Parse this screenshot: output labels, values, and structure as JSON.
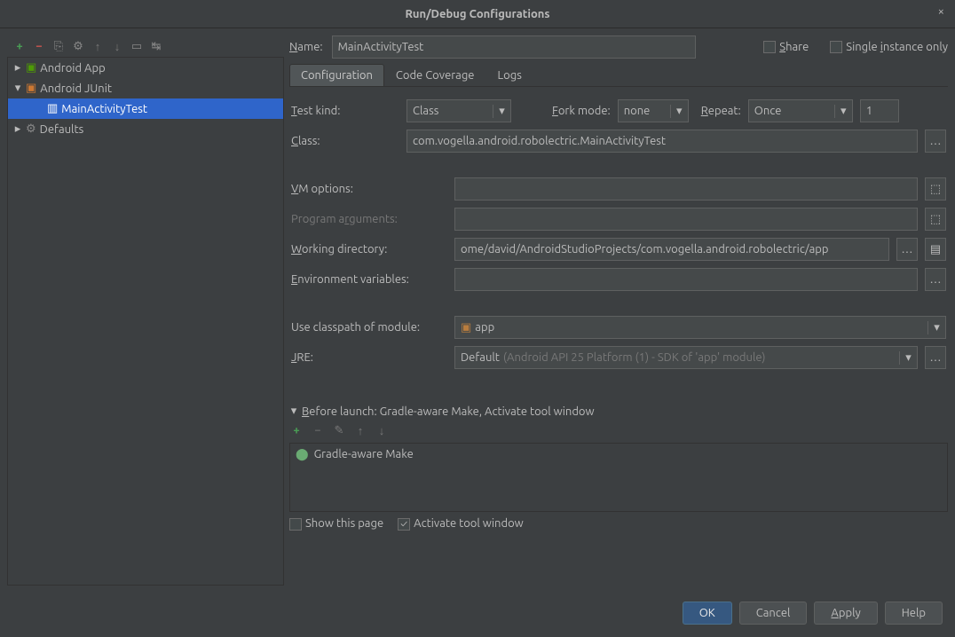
{
  "window": {
    "title": "Run/Debug Configurations"
  },
  "tree": {
    "items": [
      {
        "label": "Android App",
        "expanded": false,
        "icon": "run",
        "children": []
      },
      {
        "label": "Android JUnit",
        "expanded": true,
        "icon": "junit",
        "children": [
          {
            "label": "MainActivityTest",
            "selected": true
          }
        ]
      },
      {
        "label": "Defaults",
        "expanded": false,
        "icon": "gear",
        "children": []
      }
    ]
  },
  "header": {
    "name_label": "Name:",
    "name_value": "MainActivityTest",
    "share_label": "Share",
    "single_instance_label": "Single instance only"
  },
  "tabs": {
    "configuration": "Configuration",
    "code_coverage": "Code Coverage",
    "logs": "Logs"
  },
  "form": {
    "test_kind_label": "Test kind:",
    "test_kind_value": "Class",
    "fork_mode_label": "Fork mode:",
    "fork_mode_value": "none",
    "repeat_label": "Repeat:",
    "repeat_value": "Once",
    "repeat_count": "1",
    "class_label": "Class:",
    "class_value": "com.vogella.android.robolectric.MainActivityTest",
    "vm_options_label": "VM options:",
    "vm_options_value": "",
    "program_args_label": "Program arguments:",
    "program_args_value": "",
    "working_dir_label": "Working directory:",
    "working_dir_value": "ome/david/AndroidStudioProjects/com.vogella.android.robolectric/app",
    "env_vars_label": "Environment variables:",
    "env_vars_value": "",
    "classpath_label": "Use classpath of module:",
    "classpath_value": "app",
    "jre_label": "JRE:",
    "jre_value": "Default",
    "jre_detail": "(Android API 25 Platform (1) - SDK of 'app' module)"
  },
  "before_launch": {
    "header": "Before launch: Gradle-aware Make, Activate tool window",
    "item": "Gradle-aware Make",
    "show_page": "Show this page",
    "activate_window": "Activate tool window"
  },
  "footer": {
    "ok": "OK",
    "cancel": "Cancel",
    "apply": "Apply",
    "help": "Help"
  }
}
